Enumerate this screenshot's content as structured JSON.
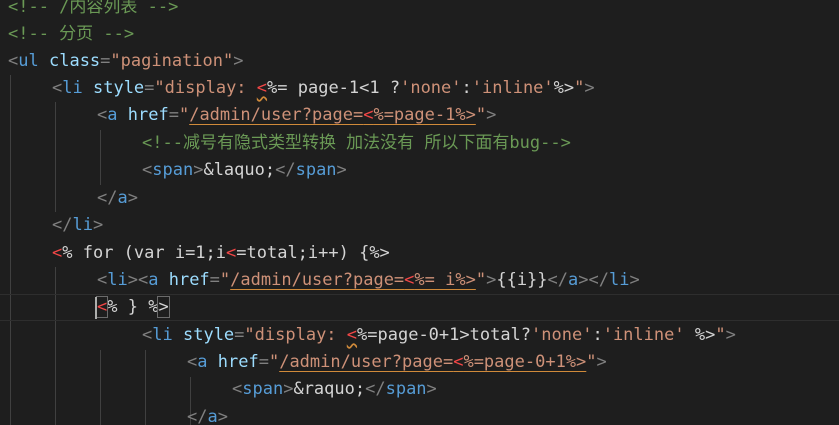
{
  "editor": {
    "lines": [
      "<!-- /内容列表 -->",
      "<!-- 分页 -->",
      "<ul class=\"pagination\">",
      "<li style=\"display: <%= page-1<1 ?'none':'inline'%>\">",
      "<a href=\"/admin/user?page=<%=page-1%>\">",
      "<!--减号有隐式类型转换 加法没有 所以下面有bug-->",
      "<span>&laquo;</span>",
      "</a>",
      "</li>",
      "<% for (var i=1;i<=total;i++) {%>",
      "<li><a href=\"/admin/user?page=<%= i%>\">{{i}}</a></li>",
      "<% } %>",
      "<li style=\"display: <%=page-0+1>total?'none':'inline' %>\">",
      "<a href=\"/admin/user?page=<%=page-0+1%>\">",
      "<span>&raquo;</span>",
      "</a>"
    ]
  }
}
